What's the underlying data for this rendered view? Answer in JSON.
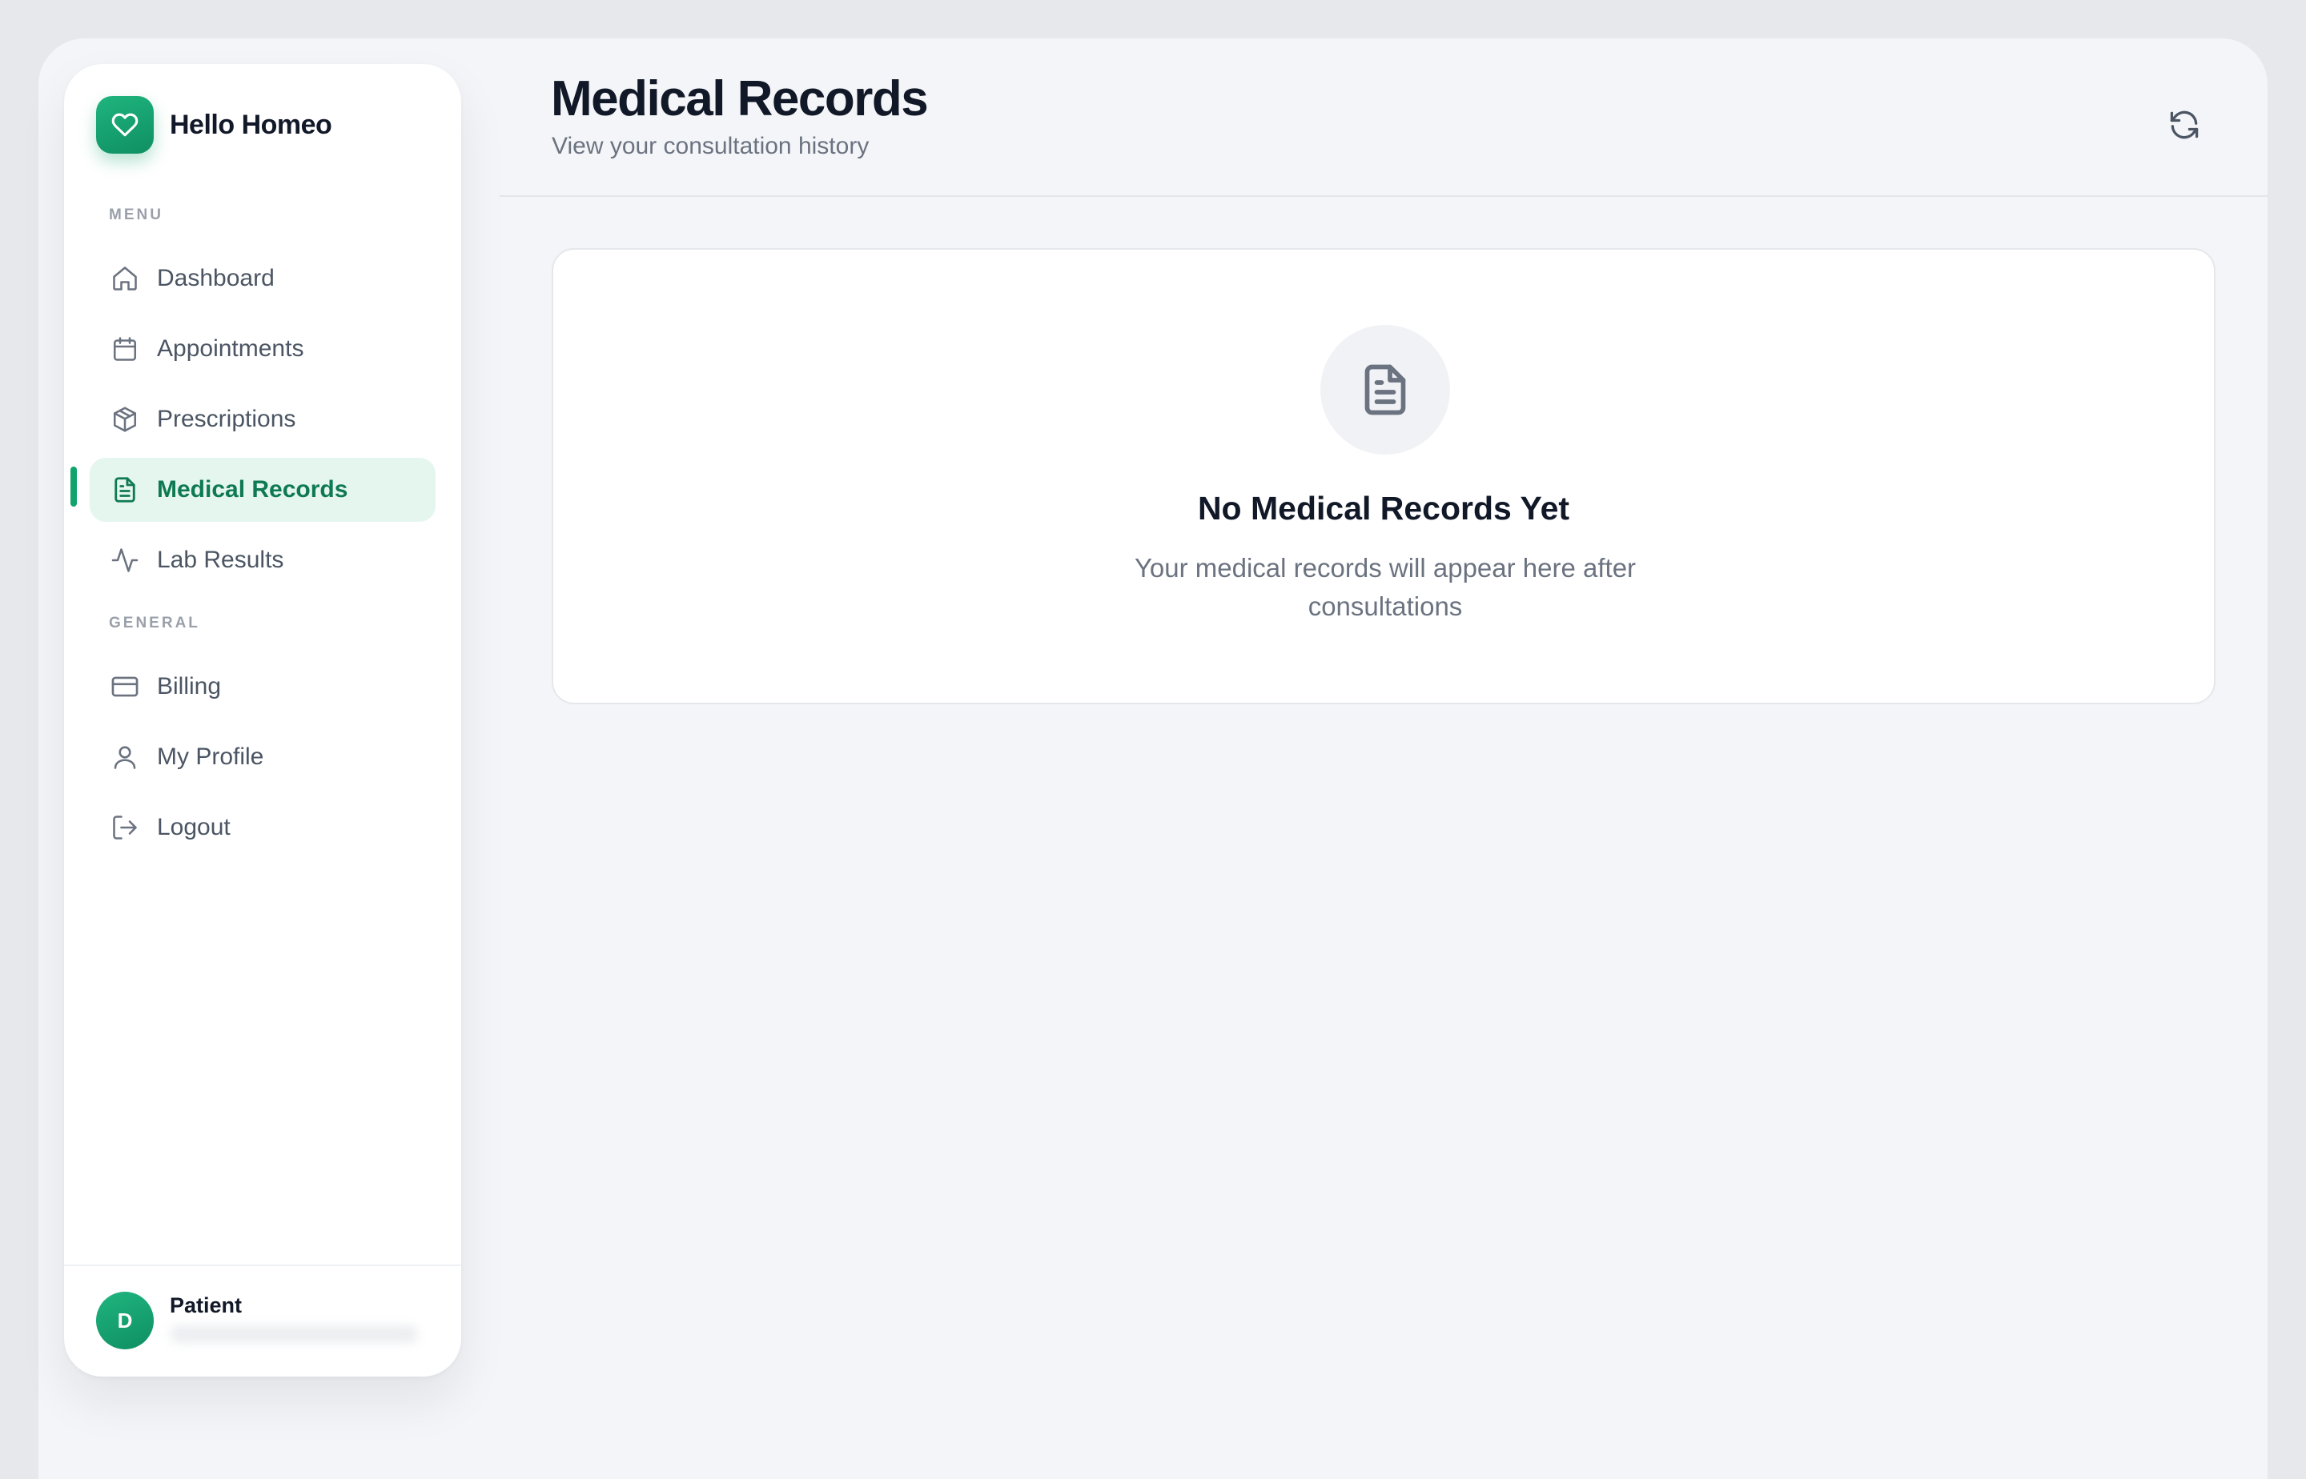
{
  "brand": {
    "name": "Hello Homeo",
    "icon": "heart-icon",
    "color": "#10a36c"
  },
  "sidebar": {
    "menu_label": "MENU",
    "menu_items": [
      {
        "label": "Dashboard",
        "icon": "home-icon",
        "active": false
      },
      {
        "label": "Appointments",
        "icon": "calendar-icon",
        "active": false
      },
      {
        "label": "Prescriptions",
        "icon": "package-icon",
        "active": false
      },
      {
        "label": "Medical Records",
        "icon": "file-text-icon",
        "active": true
      },
      {
        "label": "Lab Results",
        "icon": "activity-icon",
        "active": false
      }
    ],
    "general_label": "GENERAL",
    "general_items": [
      {
        "label": "Billing",
        "icon": "credit-card-icon"
      },
      {
        "label": "My Profile",
        "icon": "user-icon"
      },
      {
        "label": "Logout",
        "icon": "logout-icon"
      }
    ]
  },
  "user": {
    "initial": "D",
    "role": "Patient"
  },
  "header": {
    "title": "Medical Records",
    "subtitle": "View your consultation history",
    "refresh_icon": "refresh-icon"
  },
  "empty_state": {
    "icon": "file-text-icon",
    "title": "No Medical Records Yet",
    "message": "Your medical records will appear here after consultations"
  },
  "colors": {
    "accent": "#10a36c",
    "accent_dark": "#0f7a52",
    "active_bg": "#e5f6ef",
    "page_bg": "#f4f5f8"
  }
}
